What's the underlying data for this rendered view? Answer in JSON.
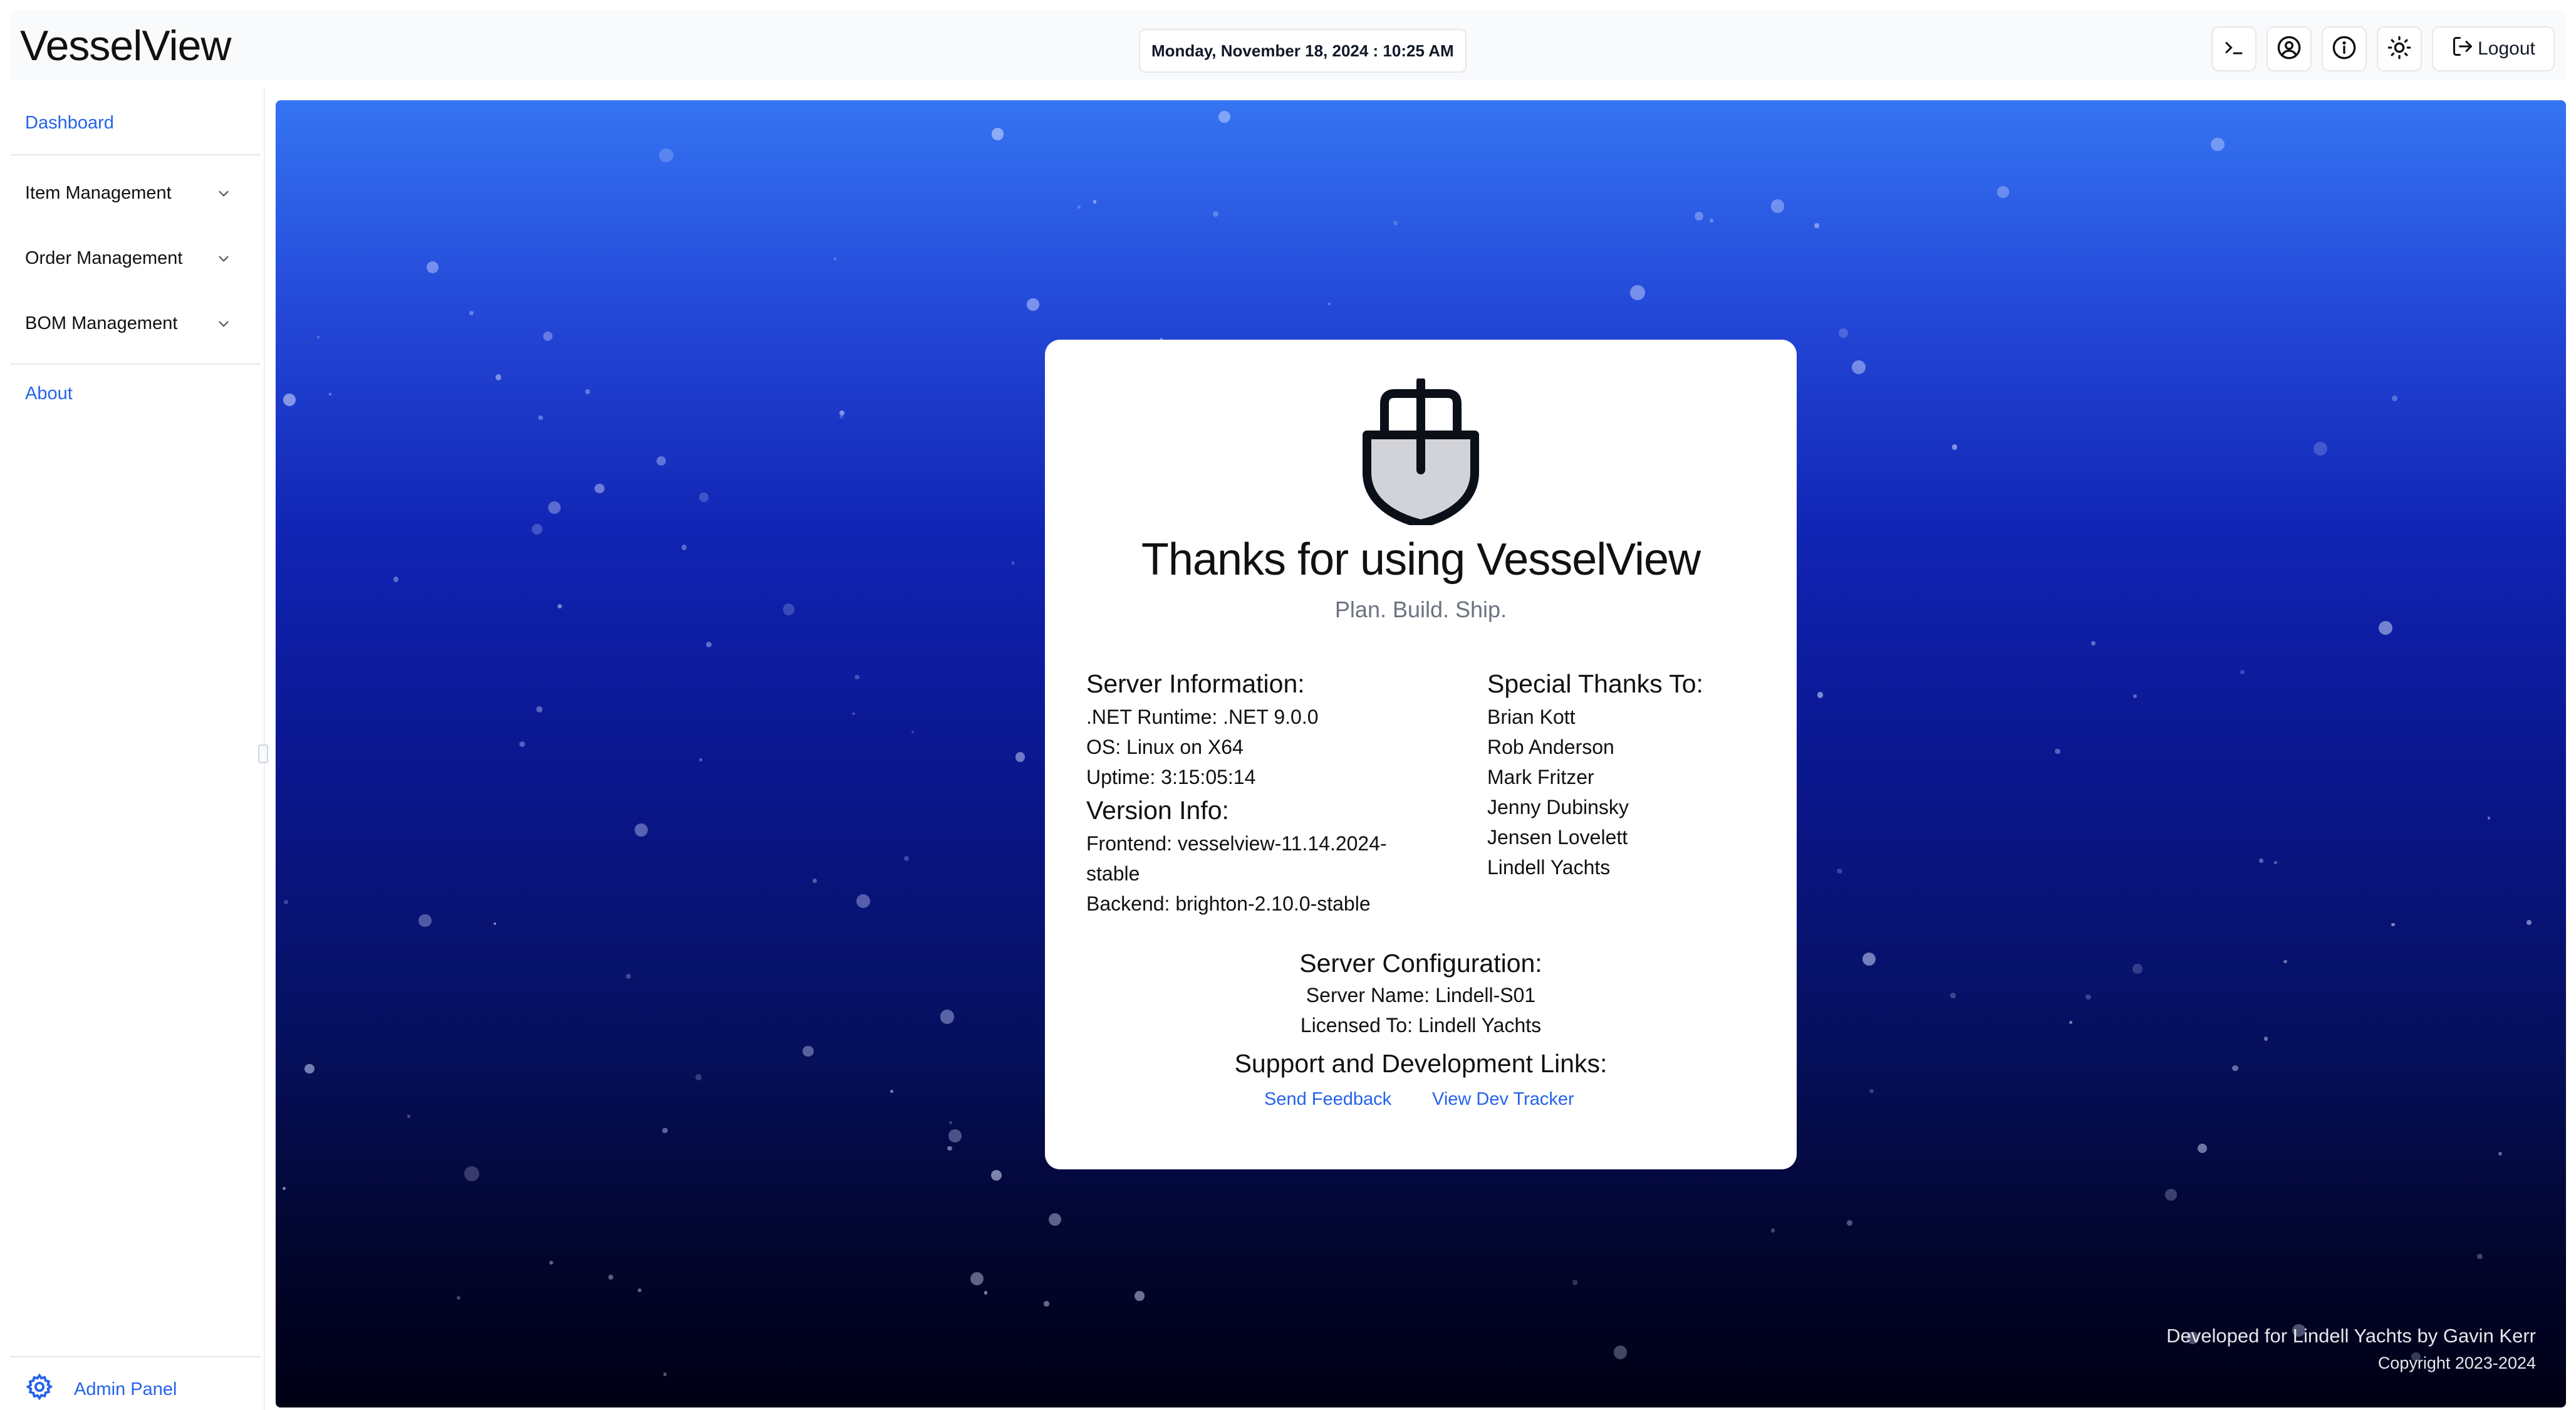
{
  "header": {
    "app_title": "VesselView",
    "datetime": "Monday, November 18, 2024 : 10:25 AM",
    "logout_label": "Logout"
  },
  "sidebar": {
    "dashboard": "Dashboard",
    "groups": [
      "Item Management",
      "Order Management",
      "BOM Management"
    ],
    "about": "About",
    "admin_panel": "Admin Panel"
  },
  "card": {
    "title": "Thanks for using VesselView",
    "tagline": "Plan. Build. Ship.",
    "server_info": {
      "heading": "Server Information:",
      "lines": [
        ".NET Runtime: .NET 9.0.0",
        "OS: Linux on X64",
        "Uptime: 3:15:05:14"
      ]
    },
    "version_info": {
      "heading": "Version Info:",
      "frontend_line1": "Frontend: vesselview-11.14.2024-",
      "frontend_line2": "stable",
      "backend": "Backend: brighton-2.10.0-stable"
    },
    "special_thanks": {
      "heading": "Special Thanks To:",
      "names": [
        "Brian Kott",
        "Rob Anderson",
        "Mark Fritzer",
        "Jenny Dubinsky",
        "Jensen Lovelett",
        "Lindell Yachts"
      ]
    },
    "server_config": {
      "heading": "Server Configuration:",
      "server_name": "Server Name: Lindell-S01",
      "licensed_to": "Licensed To: Lindell Yachts"
    },
    "links": {
      "heading": "Support and Development Links:",
      "feedback": "Send Feedback",
      "dev_tracker": "View Dev Tracker"
    }
  },
  "footer": {
    "developer": "Developed for Lindell Yachts by Gavin Kerr",
    "copyright": "Copyright 2023-2024"
  },
  "icons": [
    "terminal-icon",
    "user-circle-icon",
    "info-icon",
    "sun-icon",
    "logout-icon",
    "chevron-down-icon",
    "gear-icon",
    "boat-icon"
  ],
  "colors": {
    "accent": "#2563eb",
    "gradient_top": "#3574f2",
    "gradient_bottom": "#000014"
  }
}
